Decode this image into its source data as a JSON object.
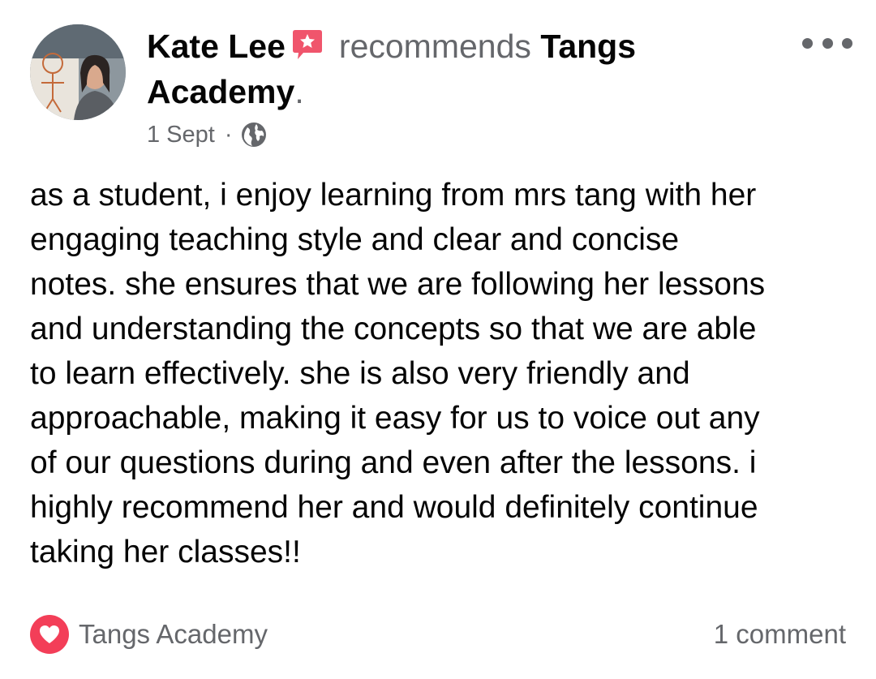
{
  "post": {
    "author": "Kate Lee",
    "action": "recommends",
    "page_name_line1": "Tangs",
    "page_name_line2": "Academy",
    "period": ".",
    "date": "1 Sept",
    "separator": "·",
    "privacy_icon": "globe-icon",
    "badge_icon": "recommendation-star-icon",
    "more_icon": "more-options-icon",
    "text": "as a student, i enjoy learning from mrs tang with her\nengaging teaching style and clear and concise\nnotes. she ensures that we are following her lessons\nand understanding the concepts so that we are able\nto learn effectively. she is also very friendly and\napproachable, making it easy for us to voice out any\nof our questions during and even after the lessons. i\nhighly recommend her and would definitely continue\ntaking her classes!!"
  },
  "footer": {
    "reaction_icon": "heart-icon",
    "reactor": "Tangs Academy",
    "comments": "1 comment"
  },
  "colors": {
    "text_primary": "#050505",
    "text_secondary": "#65676b",
    "badge": "#f0556c",
    "heart": "#f33e58"
  }
}
